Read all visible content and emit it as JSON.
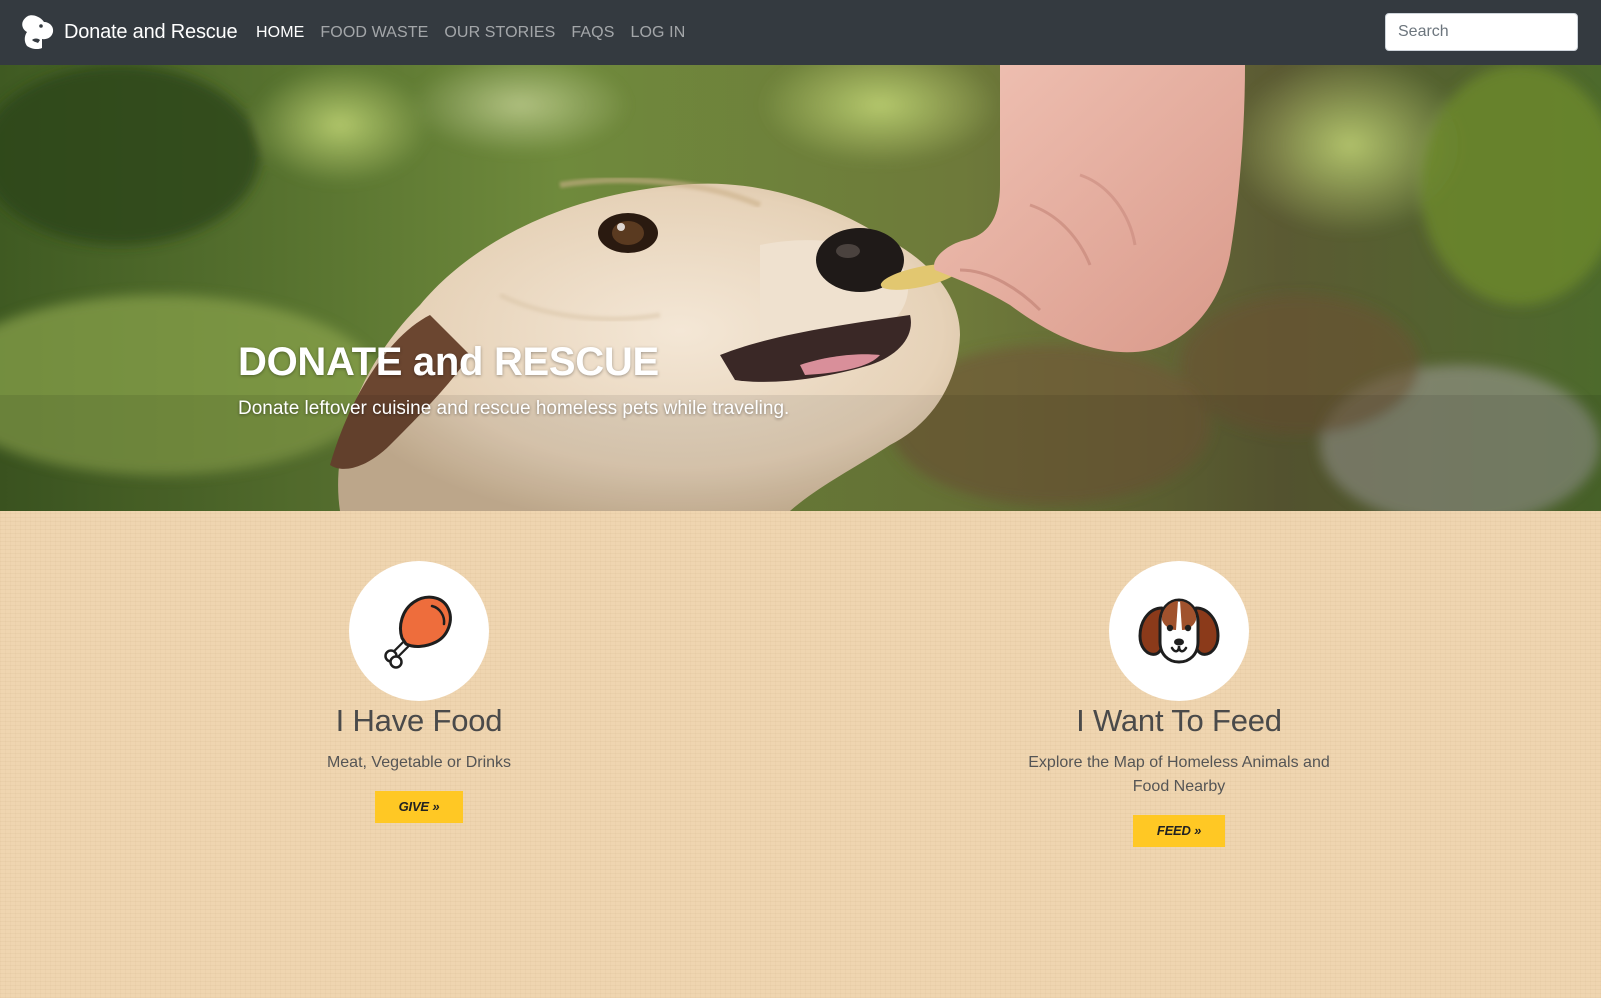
{
  "navbar": {
    "brand": "Donate and Rescue",
    "links": [
      {
        "label": "HOME",
        "active": true
      },
      {
        "label": "FOOD WASTE",
        "active": false
      },
      {
        "label": "OUR STORIES",
        "active": false
      },
      {
        "label": "FAQS",
        "active": false
      },
      {
        "label": "LOG IN",
        "active": false
      }
    ],
    "search_placeholder": "Search"
  },
  "hero": {
    "title": "DONATE and RESCUE",
    "subtitle": "Donate leftover cuisine and rescue homeless pets while traveling."
  },
  "cards": [
    {
      "icon": "chicken-leg-icon",
      "title": "I Have Food",
      "text": "Meat, Vegetable or Drinks",
      "button": "GIVE »"
    },
    {
      "icon": "puppy-face-icon",
      "title": "I Want To Feed",
      "text": "Explore the Map of Homeless Animals and Food Nearby",
      "button": "FEED »"
    }
  ],
  "colors": {
    "navbar": "#343a40",
    "background": "#efd5b0",
    "button": "#ffc824",
    "drumstick": "#ee6d3c",
    "dog_ears": "#8b3a1a"
  }
}
